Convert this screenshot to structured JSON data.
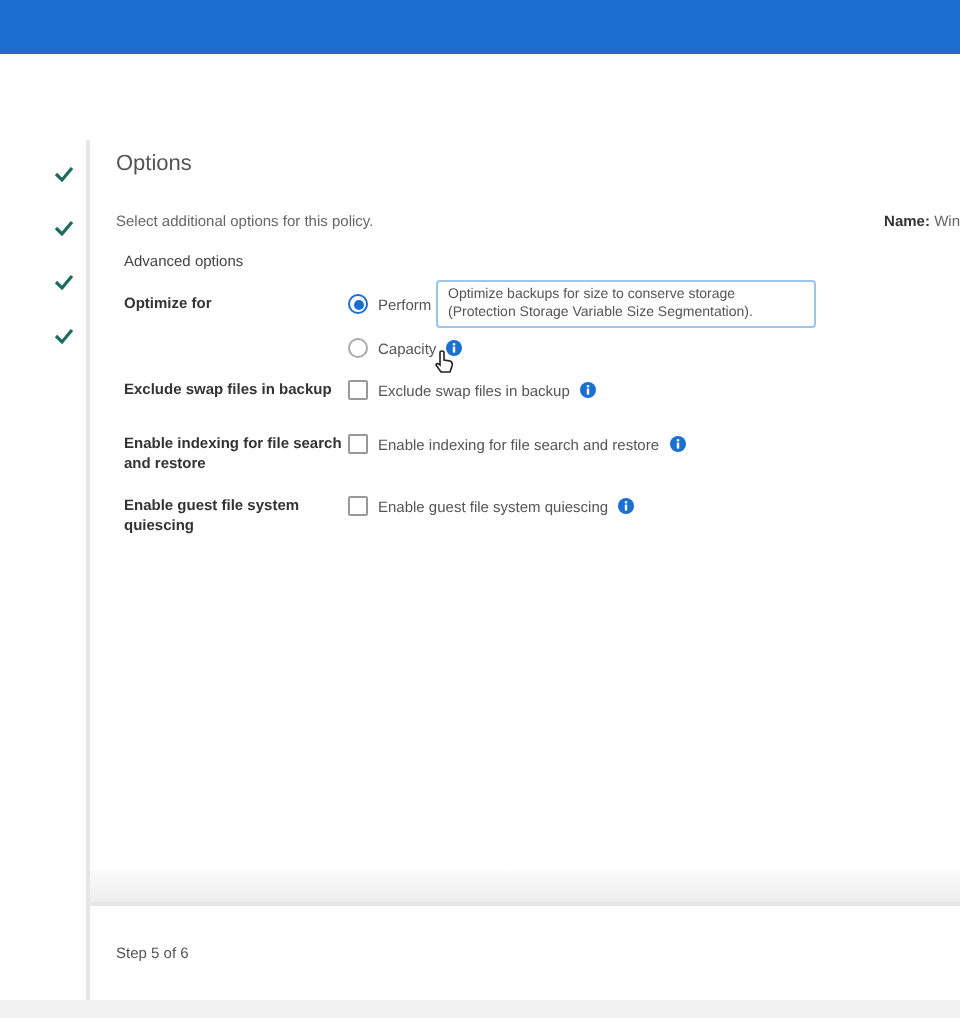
{
  "steps": [
    {
      "done": true
    },
    {
      "done": true
    },
    {
      "done": true
    },
    {
      "done": true
    }
  ],
  "title": "Options",
  "intro": "Select additional options for this policy.",
  "name_label": "Name:",
  "name_value": "Win",
  "section": "Advanced options",
  "rows": [
    {
      "kind": "radio",
      "label": "Optimize for",
      "options": [
        {
          "label": "Perform",
          "selected": true,
          "info": false
        },
        {
          "label": "Capacity",
          "selected": false,
          "info": true
        }
      ]
    },
    {
      "kind": "checkbox",
      "label": "Exclude swap files in backup",
      "option": "Exclude swap files in backup",
      "checked": false
    },
    {
      "kind": "checkbox",
      "label": "Enable indexing for file search and restore",
      "option": "Enable indexing for file search and restore",
      "checked": false
    },
    {
      "kind": "checkbox",
      "label": "Enable guest file system quiescing",
      "option": "Enable guest file system quiescing",
      "checked": false
    }
  ],
  "tooltip": "Optimize backups for size to conserve storage (Protection Storage Variable Size Segmentation).",
  "footer": "Step 5 of 6"
}
